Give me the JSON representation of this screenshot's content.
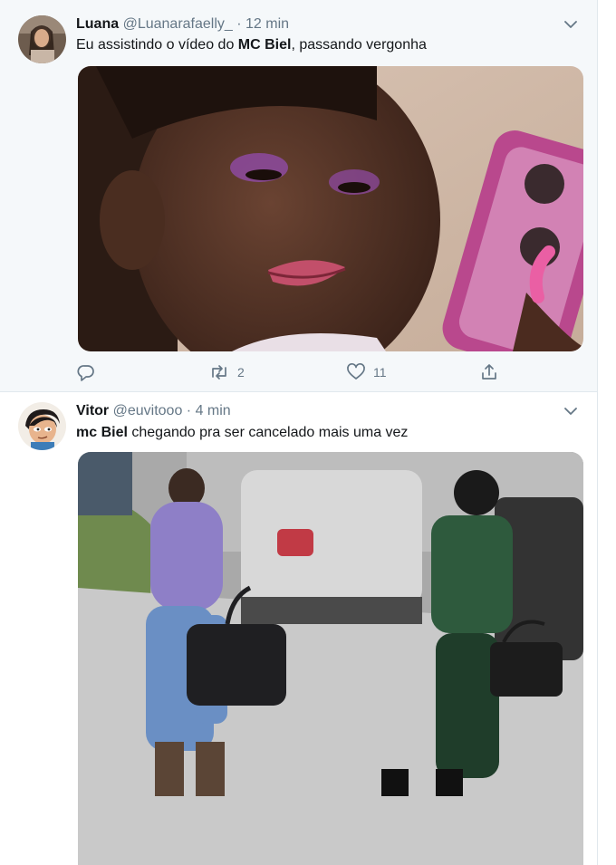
{
  "tweets": [
    {
      "author": {
        "name": "Luana",
        "handle": "@Luanarafaelly_",
        "separator": "·",
        "time": "12 min"
      },
      "text_parts": [
        "Eu assistindo o vídeo do ",
        "MC Biel",
        ", passando vergonha"
      ],
      "actions": {
        "reply_count": "",
        "retweet_count": "2",
        "like_count": "11"
      }
    },
    {
      "author": {
        "name": "Vitor",
        "handle": "@euvitooo",
        "separator": "·",
        "time": "4 min"
      },
      "text_parts": [
        "mc Biel",
        " chegando pra ser cancelado mais uma vez"
      ]
    }
  ],
  "icons": {
    "menu": "chevron-down-icon",
    "reply": "reply-icon",
    "retweet": "retweet-icon",
    "like": "heart-icon",
    "share": "share-icon"
  },
  "colors": {
    "secondary_text": "#657786",
    "primary_text": "#14171a",
    "highlight_bg": "#f5f8fa",
    "border": "#e1e8ed"
  }
}
